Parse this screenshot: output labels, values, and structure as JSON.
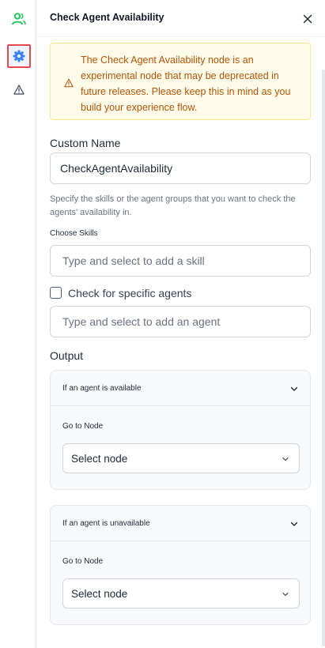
{
  "colors": {
    "accent": "#3b82f6",
    "users_icon": "#22c55e",
    "notice_bg": "#fefce8",
    "notice_text": "#b45309",
    "highlight": "#e5484d"
  },
  "rail": {
    "items": [
      {
        "icon": "users-icon"
      },
      {
        "icon": "gear-icon",
        "highlighted": true
      },
      {
        "icon": "warning-icon"
      }
    ]
  },
  "panel": {
    "title": "Check Agent Availability",
    "close_icon": "close-icon"
  },
  "notice": {
    "icon": "warning-icon",
    "text": "The Check Agent Availability node is an experimental node that may be deprecated in future releases. Please keep this in mind as you build your experience flow."
  },
  "custom_name": {
    "label": "Custom Name",
    "value": "CheckAgentAvailability"
  },
  "skills": {
    "help": "Specify the skills or the agent groups that you want to check the agents' availability in.",
    "label": "Choose Skills",
    "placeholder": "Type and select to add a skill"
  },
  "agents": {
    "checkbox_label": "Check for specific agents",
    "checked": false,
    "placeholder": "Type and select to add an agent"
  },
  "output": {
    "label": "Output",
    "cards": [
      {
        "title": "If an agent is available",
        "sub_label": "Go to Node",
        "select_value": "Select node"
      },
      {
        "title": "If an agent is unavailable",
        "sub_label": "Go to Node",
        "select_value": "Select node"
      }
    ]
  }
}
